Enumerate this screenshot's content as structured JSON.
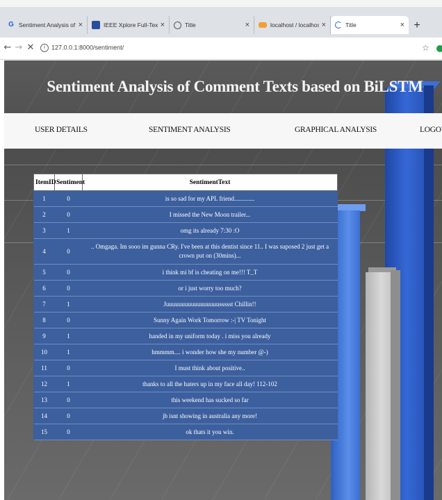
{
  "browser": {
    "tabs": [
      {
        "title": "Sentiment Analysis of Comment",
        "icon": "g-favicon-icon",
        "active": false
      },
      {
        "title": "IEEE Xplore Full-Text PDF:",
        "icon": "ieee-favicon-icon",
        "active": false
      },
      {
        "title": "Title",
        "icon": "globe-favicon-icon",
        "active": false
      },
      {
        "title": "localhost / localhost | phpMyAdr",
        "icon": "phpmyadmin-favicon-icon",
        "active": false
      },
      {
        "title": "Title",
        "icon": "loading-spinner-icon",
        "active": true
      }
    ],
    "url": "127.0.0.1:8000/sentiment/"
  },
  "banner": {
    "title": "Sentiment Analysis of Comment Texts based on BiLSTM"
  },
  "nav": {
    "items": [
      "USER DETAILS",
      "SENTIMENT ANALYSIS",
      "GRAPHICAL ANALYSIS",
      "LOGOUT"
    ]
  },
  "table": {
    "headers": [
      "ItemID",
      "Sentiment",
      "SentimentText"
    ],
    "rows": [
      {
        "id": "1",
        "sentiment": "0",
        "text": "is so sad for my APL friend............."
      },
      {
        "id": "2",
        "sentiment": "0",
        "text": "I missed the New Moon trailer..."
      },
      {
        "id": "3",
        "sentiment": "1",
        "text": "omg its already 7:30 :O"
      },
      {
        "id": "4",
        "sentiment": "0",
        "text": ".. Omgaga. Im sooo im gunna CRy. I've been at this dentist since 11.. I was suposed 2 just get a crown put on (30mins)..."
      },
      {
        "id": "5",
        "sentiment": "0",
        "text": "i think mi bf is cheating on me!!! T_T"
      },
      {
        "id": "6",
        "sentiment": "0",
        "text": "or i just worry too much?"
      },
      {
        "id": "7",
        "sentiment": "1",
        "text": "Juuuuuuuuuuuuuuuuussssst Chillin!!"
      },
      {
        "id": "8",
        "sentiment": "0",
        "text": "Sunny Again Work Tomorrow :-| TV Tonight"
      },
      {
        "id": "9",
        "sentiment": "1",
        "text": "handed in my uniform today . i miss you already"
      },
      {
        "id": "10",
        "sentiment": "1",
        "text": "hmmmm.... i wonder how she my number @-)"
      },
      {
        "id": "11",
        "sentiment": "0",
        "text": "I must think about positive.."
      },
      {
        "id": "12",
        "sentiment": "1",
        "text": "thanks to all the haters up in my face all day! 112-102"
      },
      {
        "id": "13",
        "sentiment": "0",
        "text": "this weekend has sucked so far"
      },
      {
        "id": "14",
        "sentiment": "0",
        "text": "jb isnt showing in australia any more!"
      },
      {
        "id": "15",
        "sentiment": "0",
        "text": "ok thats it you win."
      }
    ]
  }
}
